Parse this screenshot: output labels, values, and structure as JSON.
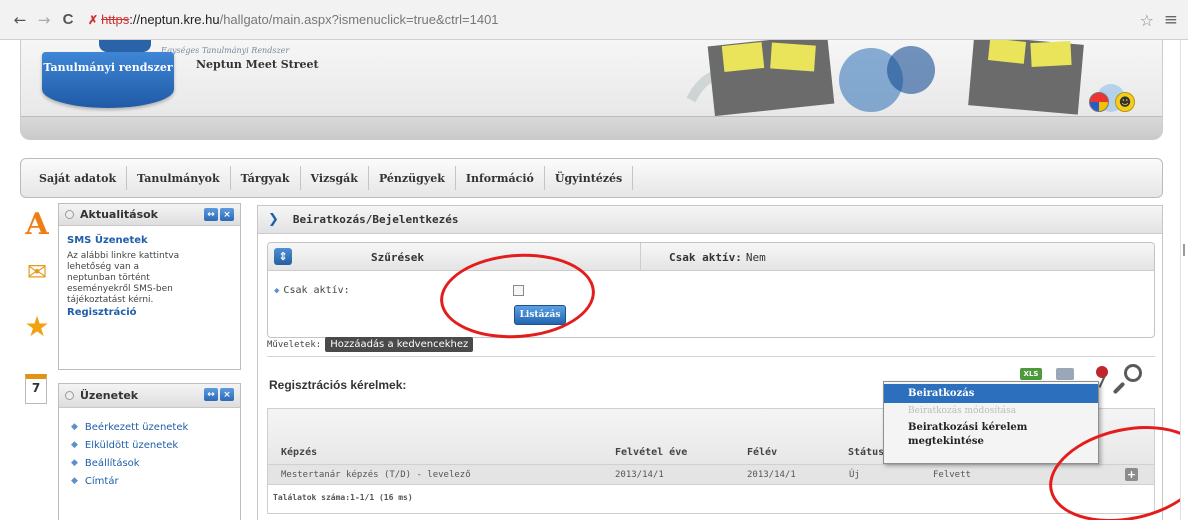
{
  "browser": {
    "back": "←",
    "forward": "→",
    "reload": "C",
    "url_scheme": "https",
    "url_host": "://neptun.kre.hu",
    "url_rest": "/hallgato/main.aspx?ismenuclick=true&ctrl=1401",
    "star": "☆",
    "menu": "≡"
  },
  "header": {
    "logo_subtitle": "Egységes Tanulmányi Rendszer",
    "tab_label": "Tanulmányi rendszer",
    "site_name": "Neptun Meet Street"
  },
  "main_menu": {
    "items": [
      {
        "label": "Saját adatok"
      },
      {
        "label": "Tanulmányok"
      },
      {
        "label": "Tárgyak"
      },
      {
        "label": "Vizsgák"
      },
      {
        "label": "Pénzügyek"
      },
      {
        "label": "Információ"
      },
      {
        "label": "Ügyintézés"
      }
    ]
  },
  "side_icons": {
    "a": "A",
    "envelope": "✉",
    "star": "★",
    "calendar_day": "7"
  },
  "aktualitasok": {
    "title": "Aktualitások",
    "sms_title": "SMS Üzenetek",
    "sms_text": "Az alábbi linkre kattintva lehetőség van a neptunban történt eseményekről SMS-ben tájékoztatást kérni.",
    "sms_link": "Regisztráció"
  },
  "uzenetek": {
    "title": "Üzenetek",
    "items": [
      {
        "label": "Beérkezett üzenetek"
      },
      {
        "label": "Elküldött üzenetek"
      },
      {
        "label": "Beállítások"
      },
      {
        "label": "Címtár"
      }
    ]
  },
  "content": {
    "title": "Beiratkozás/Bejelentkezés",
    "filter": {
      "toggle": "⇕",
      "title": "Szűrések",
      "csak_aktiv_label": "Csak aktív:",
      "csak_aktiv_value": "Nem",
      "row_label": "Csak aktív:",
      "list_button": "Listázás"
    },
    "muveletek_label": "Műveletek:",
    "favorite_button": "Hozzáadás a kedvencekhez",
    "reg_title": "Regisztrációs kérelmek:",
    "table": {
      "headers": [
        "Képzés",
        "Felvétel éve",
        "Félév",
        "Státus"
      ],
      "row": {
        "kepzes": "Mestertanár képzés (T/D) - levelező",
        "felvetel_eve": "2013/14/1",
        "felev": "2013/14/1",
        "statusz": "Új",
        "allapot": "Felvett",
        "plus": "+"
      },
      "result_count": "Találatok száma:1-1/1 (16 ms)"
    }
  },
  "context_menu": {
    "items": [
      {
        "label": "Beiratkozás",
        "state": "active"
      },
      {
        "label": "Beiratkozás módosítása",
        "state": "disabled"
      },
      {
        "label": "Beiratkozási kérelem megtekintése",
        "state": "normal"
      }
    ]
  },
  "colors": {
    "accent_blue": "#2b6fbd",
    "annotation_red": "#e41c1c",
    "link_blue": "#1f5ea8"
  }
}
